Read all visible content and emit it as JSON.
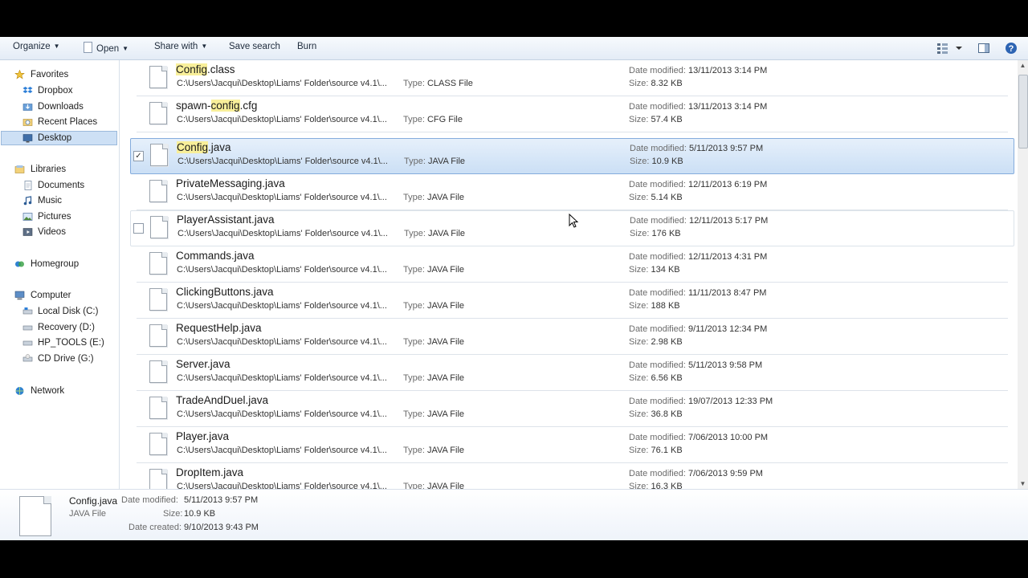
{
  "toolbar": {
    "organize": "Organize",
    "open": "Open",
    "share_with": "Share with",
    "save_search": "Save search",
    "burn": "Burn"
  },
  "sidebar": {
    "favorites": "Favorites",
    "dropbox": "Dropbox",
    "downloads": "Downloads",
    "recent_places": "Recent Places",
    "desktop": "Desktop",
    "libraries": "Libraries",
    "documents": "Documents",
    "music": "Music",
    "pictures": "Pictures",
    "videos": "Videos",
    "homegroup": "Homegroup",
    "computer": "Computer",
    "local_disk": "Local Disk (C:)",
    "recovery": "Recovery (D:)",
    "hp_tools": "HP_TOOLS (E:)",
    "cd_drive": "CD Drive (G:)",
    "network": "Network"
  },
  "labels": {
    "type": "Type:",
    "date_modified": "Date modified:",
    "size": "Size:"
  },
  "files": [
    {
      "name_pre": "",
      "name_hl": "Config",
      "name_post": ".class",
      "path": "C:\\Users\\Jacqui\\Desktop\\Liams' Folder\\source v4.1\\...",
      "type": "CLASS File",
      "date": "13/11/2013 3:14 PM",
      "size": "8.32 KB"
    },
    {
      "name_pre": "spawn-",
      "name_hl": "config",
      "name_post": ".cfg",
      "path": "C:\\Users\\Jacqui\\Desktop\\Liams' Folder\\source v4.1\\...",
      "type": "CFG File",
      "date": "13/11/2013 3:14 PM",
      "size": "57.4 KB"
    },
    {
      "name_pre": "",
      "name_hl": "Config",
      "name_post": ".java",
      "path": "C:\\Users\\Jacqui\\Desktop\\Liams' Folder\\source v4.1\\...",
      "type": "JAVA File",
      "date": "5/11/2013 9:57 PM",
      "size": "10.9 KB"
    },
    {
      "name_pre": "PrivateMessaging.java",
      "name_hl": "",
      "name_post": "",
      "path": "C:\\Users\\Jacqui\\Desktop\\Liams' Folder\\source v4.1\\...",
      "type": "JAVA File",
      "date": "12/11/2013 6:19 PM",
      "size": "5.14 KB"
    },
    {
      "name_pre": "PlayerAssistant.java",
      "name_hl": "",
      "name_post": "",
      "path": "C:\\Users\\Jacqui\\Desktop\\Liams' Folder\\source v4.1\\...",
      "type": "JAVA File",
      "date": "12/11/2013 5:17 PM",
      "size": "176 KB"
    },
    {
      "name_pre": "Commands.java",
      "name_hl": "",
      "name_post": "",
      "path": "C:\\Users\\Jacqui\\Desktop\\Liams' Folder\\source v4.1\\...",
      "type": "JAVA File",
      "date": "12/11/2013 4:31 PM",
      "size": "134 KB"
    },
    {
      "name_pre": "ClickingButtons.java",
      "name_hl": "",
      "name_post": "",
      "path": "C:\\Users\\Jacqui\\Desktop\\Liams' Folder\\source v4.1\\...",
      "type": "JAVA File",
      "date": "11/11/2013 8:47 PM",
      "size": "188 KB"
    },
    {
      "name_pre": "RequestHelp.java",
      "name_hl": "",
      "name_post": "",
      "path": "C:\\Users\\Jacqui\\Desktop\\Liams' Folder\\source v4.1\\...",
      "type": "JAVA File",
      "date": "9/11/2013 12:34 PM",
      "size": "2.98 KB"
    },
    {
      "name_pre": "Server.java",
      "name_hl": "",
      "name_post": "",
      "path": "C:\\Users\\Jacqui\\Desktop\\Liams' Folder\\source v4.1\\...",
      "type": "JAVA File",
      "date": "5/11/2013 9:58 PM",
      "size": "6.56 KB"
    },
    {
      "name_pre": "TradeAndDuel.java",
      "name_hl": "",
      "name_post": "",
      "path": "C:\\Users\\Jacqui\\Desktop\\Liams' Folder\\source v4.1\\...",
      "type": "JAVA File",
      "date": "19/07/2013 12:33 PM",
      "size": "36.8 KB"
    },
    {
      "name_pre": "Player.java",
      "name_hl": "",
      "name_post": "",
      "path": "C:\\Users\\Jacqui\\Desktop\\Liams' Folder\\source v4.1\\...",
      "type": "JAVA File",
      "date": "7/06/2013 10:00 PM",
      "size": "76.1 KB"
    },
    {
      "name_pre": "DropItem.java",
      "name_hl": "",
      "name_post": "",
      "path": "C:\\Users\\Jacqui\\Desktop\\Liams' Folder\\source v4.1\\...",
      "type": "JAVA File",
      "date": "7/06/2013 9:59 PM",
      "size": "16.3 KB"
    }
  ],
  "details": {
    "name": "Config.java",
    "type": "JAVA File",
    "date_modified_label": "Date modified:",
    "date_modified": "5/11/2013 9:57 PM",
    "size_label": "Size:",
    "size": "10.9 KB",
    "date_created_label": "Date created:",
    "date_created": "9/10/2013 9:43 PM"
  }
}
